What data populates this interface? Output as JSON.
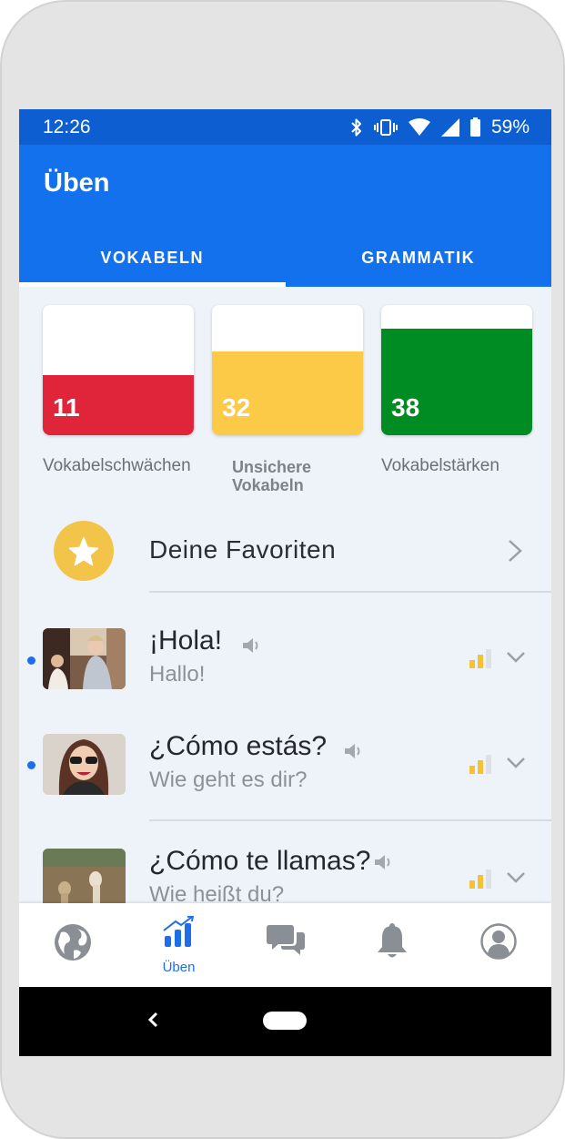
{
  "status_bar": {
    "time": "12:26",
    "battery": "59%"
  },
  "app_bar": {
    "title": "Üben"
  },
  "tabs": [
    {
      "label": "VOKABELN",
      "active": true
    },
    {
      "label": "GRAMMATIK",
      "active": false
    }
  ],
  "stats": [
    {
      "count": "11",
      "label": "Vokabelschwächen",
      "color": "#e0243a",
      "fill": 0.46
    },
    {
      "count": "32",
      "label": "Unsichere Vokabeln",
      "color": "#fcca47",
      "fill": 0.64
    },
    {
      "count": "38",
      "label": "Vokabelstärken",
      "color": "#008b23",
      "fill": 0.82
    }
  ],
  "favorites": {
    "label": "Deine Favoriten"
  },
  "phrases": [
    {
      "title": "¡Hola!",
      "translation": "Hallo!",
      "is_new": true,
      "strength_level": 2
    },
    {
      "title": "¿Cómo estás?",
      "translation": "Wie geht es dir?",
      "is_new": true,
      "strength_level": 2
    },
    {
      "title": "¿Cómo te llamas?",
      "translation": "Wie heißt du?",
      "is_new": false,
      "strength_level": 2
    }
  ],
  "bottom_nav": [
    {
      "icon": "globe-icon",
      "label": ""
    },
    {
      "icon": "practice-chart-icon",
      "label": "Üben",
      "active": true
    },
    {
      "icon": "chat-bubbles-icon",
      "label": ""
    },
    {
      "icon": "bell-icon",
      "label": ""
    },
    {
      "icon": "profile-icon",
      "label": ""
    }
  ],
  "colors": {
    "primary": "#1471ed",
    "status_bar": "#0d5ed1",
    "accent_blue": "#1c6fe8",
    "favorite_gold": "#f3c44a"
  }
}
